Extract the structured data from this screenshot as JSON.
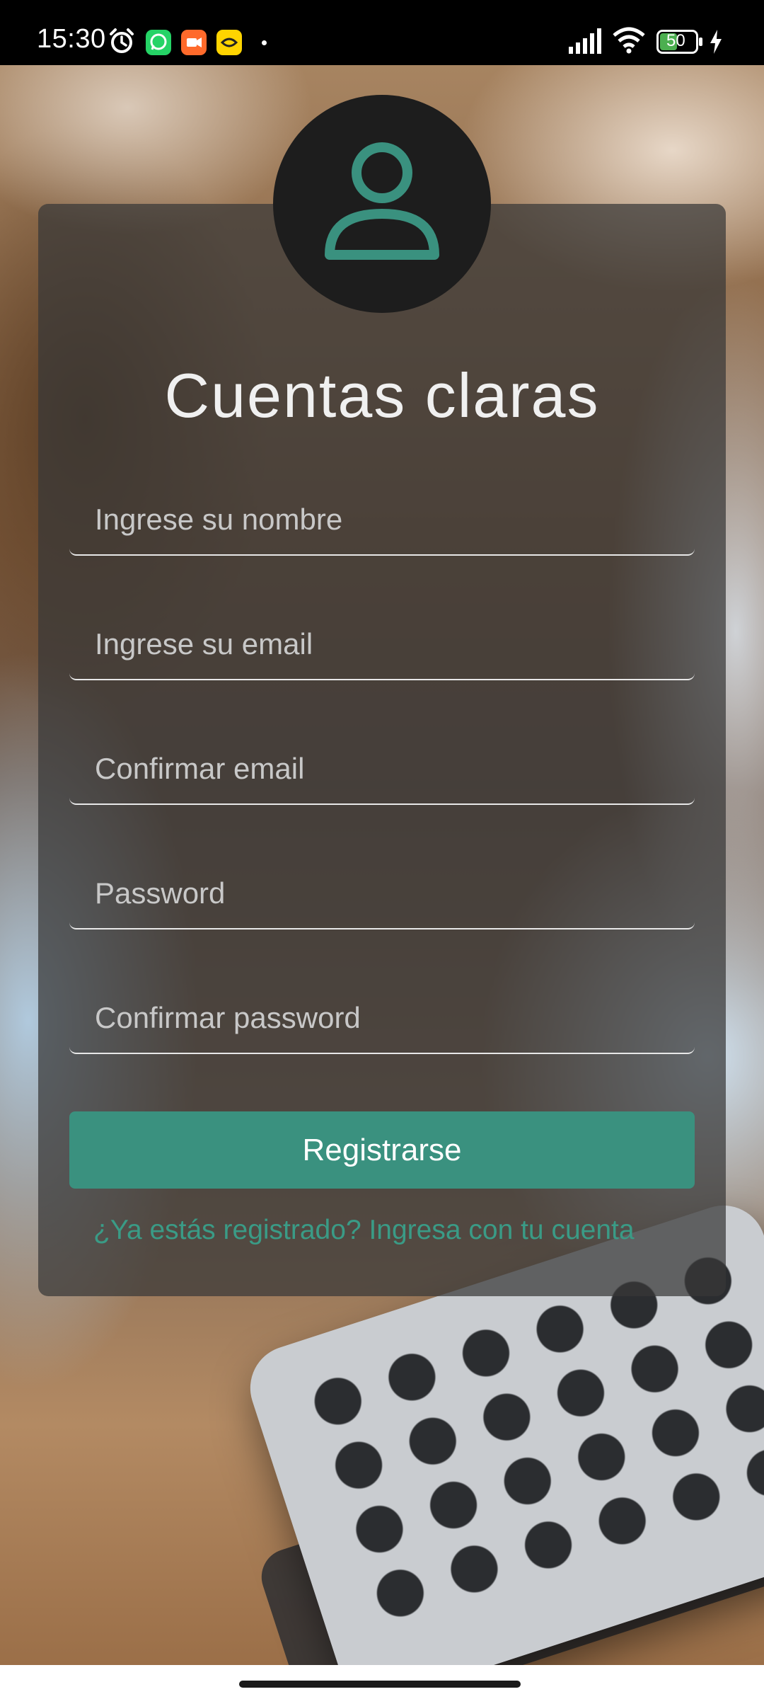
{
  "status_bar": {
    "time": "15:30",
    "battery": "50",
    "icons": [
      "alarm-icon",
      "whatsapp-icon",
      "video-app-icon",
      "yellow-app-icon",
      "notification-dot-icon",
      "signal-icon",
      "wifi-icon",
      "battery-icon",
      "charging-icon"
    ]
  },
  "colors": {
    "accent": "#3a917f",
    "link": "#3a9b86",
    "card_bg": "rgba(55,55,55,0.72)"
  },
  "form": {
    "title": "Cuentas claras",
    "avatar_icon": "user-icon",
    "fields": [
      {
        "placeholder": "Ingrese su nombre",
        "value": ""
      },
      {
        "placeholder": "Ingrese su email",
        "value": ""
      },
      {
        "placeholder": "Confirmar email",
        "value": ""
      },
      {
        "placeholder": "Password",
        "value": ""
      },
      {
        "placeholder": "Confirmar password",
        "value": ""
      }
    ],
    "submit_label": "Registrarse",
    "login_link": "¿Ya estás registrado? Ingresa con tu cuenta"
  }
}
